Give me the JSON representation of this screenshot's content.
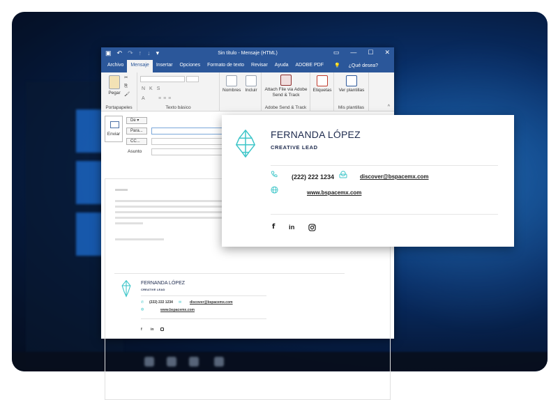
{
  "window": {
    "title": "Sin título  -  Mensaje (HTML)"
  },
  "ribbon": {
    "tabs": [
      {
        "label": "Archivo"
      },
      {
        "label": "Mensaje"
      },
      {
        "label": "Insertar"
      },
      {
        "label": "Opciones"
      },
      {
        "label": "Formato de texto"
      },
      {
        "label": "Revisar"
      },
      {
        "label": "Ayuda"
      },
      {
        "label": "ADOBE PDF"
      },
      {
        "label": "¿Qué desea?"
      }
    ],
    "paste_label": "Pegar",
    "clipboard_group": "Portapapeles",
    "basic_text_group": "Texto básico",
    "names_label": "Nombres",
    "include_label": "Incluir",
    "attach_label": "Attach File via Adobe Send & Track",
    "adobe_group": "Adobe Send & Track",
    "tags_label": "Etiquetas",
    "templates_button": "Ver plantillas",
    "templates_group": "Mis plantillas"
  },
  "compose": {
    "send_label": "Enviar",
    "from_label": "De",
    "to_label": "Para...",
    "cc_label": "CC...",
    "subject_label": "Asunto"
  },
  "signature": {
    "name": "FERNANDA LÓPEZ",
    "role": "CREATIVE LEAD",
    "phone": "(222) 222 1234",
    "email": "discover@bspacemx.com",
    "website": "www.bspacemx.com",
    "social": [
      "f",
      "in"
    ],
    "accent_color": "#3ec6c9"
  }
}
